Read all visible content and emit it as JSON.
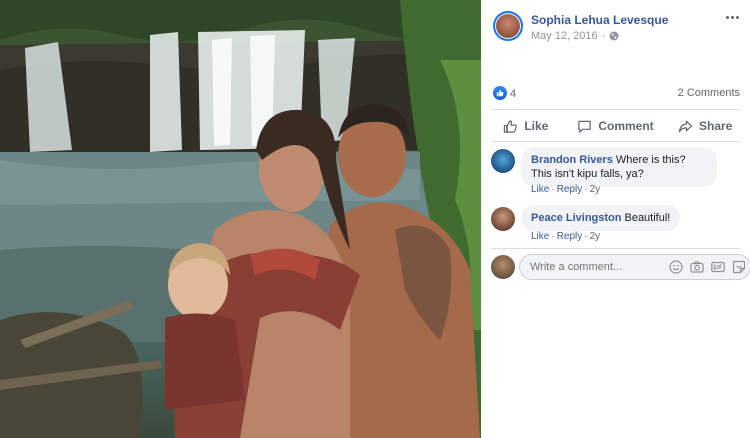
{
  "post": {
    "author": "Sophia Lehua Levesque",
    "date": "May 12, 2016",
    "privacy_icon": "globe-icon",
    "more_icon": "more-options-icon"
  },
  "stats": {
    "reaction_icon": "like-reaction-icon",
    "like_count": "4",
    "comments_count": "2 Comments"
  },
  "actions": [
    {
      "label": "Like",
      "icon": "thumbs-up-icon"
    },
    {
      "label": "Comment",
      "icon": "comment-icon"
    },
    {
      "label": "Share",
      "icon": "share-icon"
    }
  ],
  "comments": [
    {
      "name": "Brandon Rivers",
      "text": "Where is this? This isn't kipu falls, ya?",
      "like": "Like",
      "reply": "Reply",
      "time": "2y"
    },
    {
      "name": "Peace Livingston",
      "text": "Beautiful!",
      "like": "Like",
      "reply": "Reply",
      "time": "2y"
    }
  ],
  "composer": {
    "placeholder": "Write a comment...",
    "icons": [
      "emoji-icon",
      "camera-icon",
      "gif-icon",
      "sticker-icon"
    ]
  },
  "colors": {
    "link": "#385898",
    "accent": "#1877f2",
    "muted": "#606770",
    "bubble": "#f2f3f5"
  }
}
